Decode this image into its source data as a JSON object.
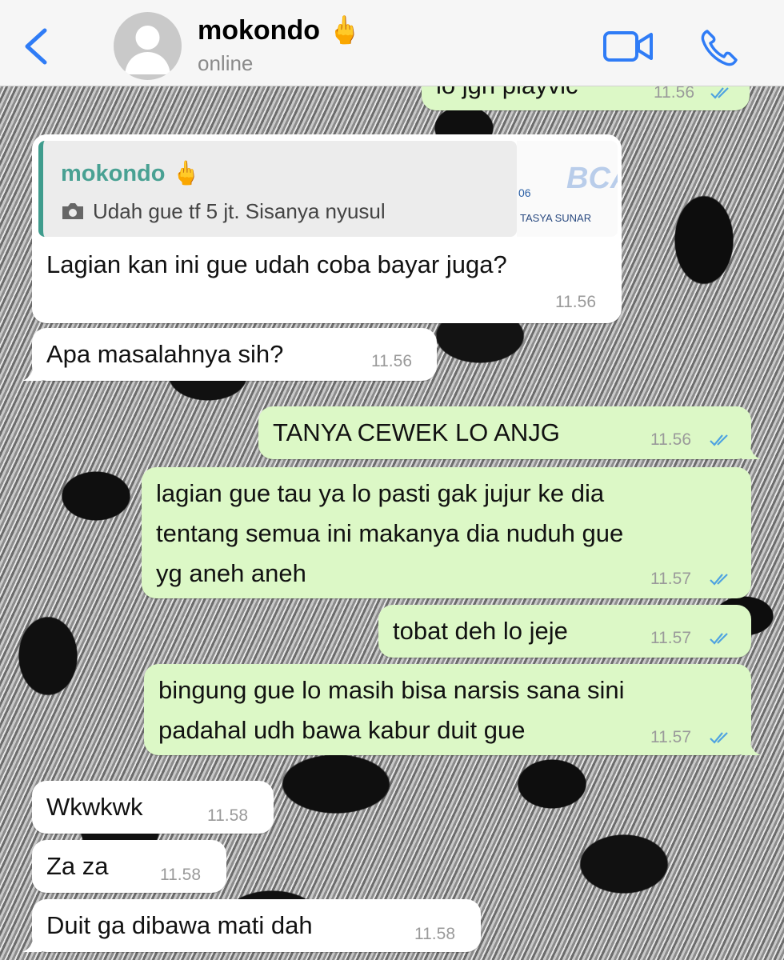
{
  "header": {
    "back_label": "",
    "contact_name": "mokondo",
    "contact_emoji": "🖕",
    "status": "online"
  },
  "top_partial": {
    "text": "lo jgn playvic",
    "time": "11.56"
  },
  "reply_message": {
    "quote_name": "mokondo",
    "quote_emoji": "🖕",
    "quote_text": "Udah gue tf 5 jt. Sisanya nyusul",
    "thumb_num": "06",
    "thumb_brand": "BCA",
    "thumb_name": "TASYA SUNAR",
    "text": "Lagian kan ini gue udah coba bayar juga?",
    "time": "11.56"
  },
  "messages": [
    {
      "text": "Apa masalahnya sih?",
      "time": "11.56"
    },
    {
      "text": "TANYA CEWEK LO ANJG",
      "time": "11.56"
    },
    {
      "text": "lagian gue tau ya lo pasti gak jujur ke dia\ntentang semua ini makanya dia nuduh gue\nyg aneh aneh",
      "time": "11.57"
    },
    {
      "text": "tobat deh lo jeje",
      "time": "11.57"
    },
    {
      "text": "bingung gue lo masih bisa narsis sana sini\npadahal udh bawa kabur duit gue",
      "time": "11.57"
    },
    {
      "text": "Wkwkwk",
      "time": "11.58"
    },
    {
      "text": "Za za",
      "time": "11.58"
    },
    {
      "text": "Duit ga dibawa mati dah",
      "time": "11.58"
    }
  ],
  "colors": {
    "accent_blue": "#2f7cf6",
    "outgoing_bubble": "#dcf8c6",
    "incoming_bubble": "#ffffff",
    "quote_name": "#49a193",
    "ticks": "#4fa3e0"
  }
}
